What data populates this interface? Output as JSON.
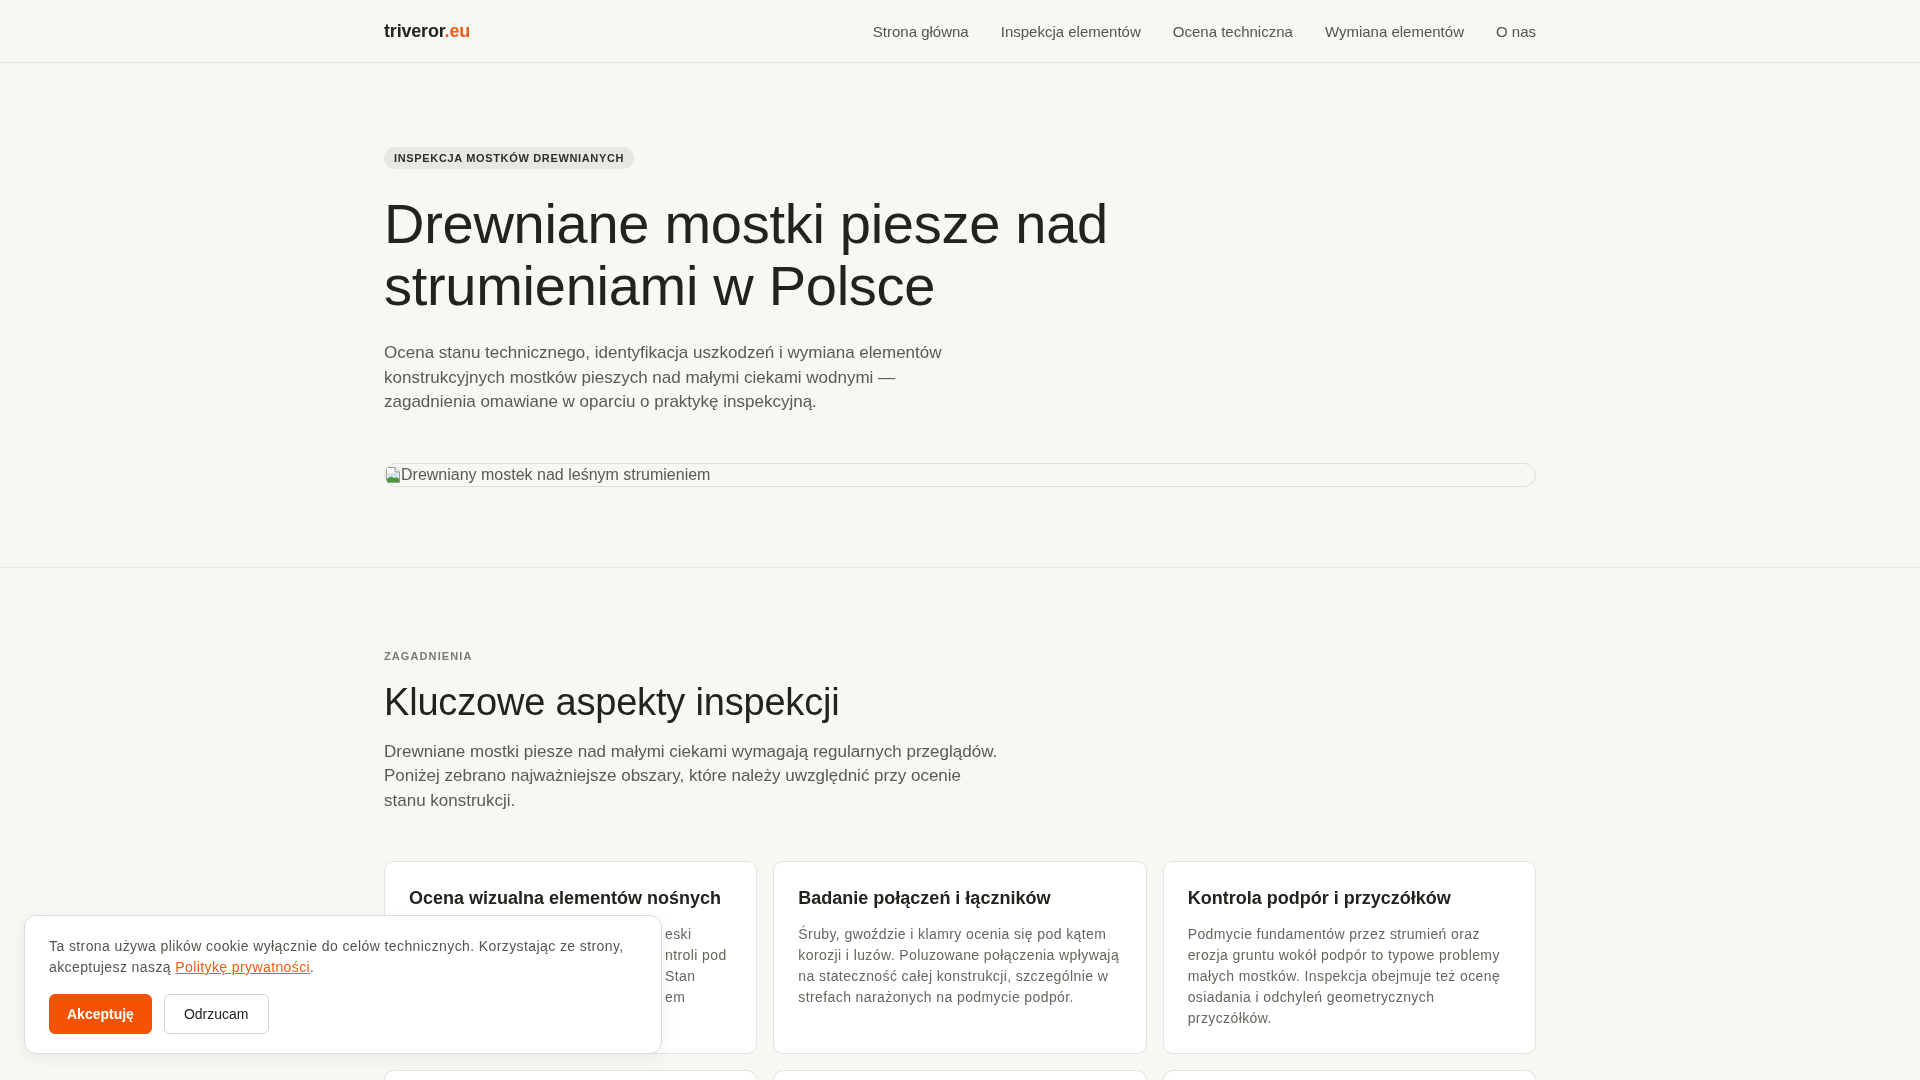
{
  "header": {
    "logo": {
      "name": "triveror",
      "suffix": ".eu"
    },
    "nav": [
      "Strona główna",
      "Inspekcja elementów",
      "Ocena techniczna",
      "Wymiana elementów",
      "O nas"
    ]
  },
  "hero": {
    "badge": "INSPEKCJA MOSTKÓW DREWNIANYCH",
    "title": "Drewniane mostki piesze nad strumieniami w Polsce",
    "intro": "Ocena stanu technicznego, identyfikacja uszkodzeń i wymiana elementów konstrukcyjnych mostków pieszych nad małymi ciekami wodnymi — zagadnienia omawiane w oparciu o praktykę inspekcyjną.",
    "image": {
      "alt_text": "Drewniany mostek nad leśnym strumieniem"
    }
  },
  "topics": {
    "eyebrow": "ZAGADNIENIA",
    "title": "Kluczowe aspekty inspekcji",
    "intro": "Drewniane mostki piesze nad małymi ciekami wymagają regularnych przeglądów. Poniżej zebrano najważniejsze obszary, które należy uwzględnić przy ocenie stanu konstrukcji.",
    "cards": [
      {
        "kind": "covered",
        "title": "Ocena wizualna elementów nośnych",
        "visible_fragments": [
          "eski",
          "ntroli pod",
          "Stan",
          "em"
        ]
      },
      {
        "kind": "full",
        "title": "Badanie połączeń i łączników",
        "body": "Śruby, gwoździe i klamry ocenia się pod kątem korozji i luzów. Poluzowane połączenia wpływają na stateczność całej konstrukcji, szczególnie w strefach narażonych na podmycie podpór."
      },
      {
        "kind": "full",
        "title": "Kontrola podpór i przyczółków",
        "body": "Podmycie fundamentów przez strumień oraz erozja gruntu wokół podpór to typowe problemy małych mostków. Inspekcja obejmuje też ocenę osiadania i odchyleń geometrycznych przyczółków."
      },
      {
        "kind": "cut_off"
      },
      {
        "kind": "cut_off"
      },
      {
        "kind": "cut_off"
      }
    ]
  },
  "cookie_banner": {
    "text": "Ta strona używa plików cookie wyłącznie do celów technicznych. Korzystając ze strony, akceptujesz naszą",
    "link": "Politykę prywatności",
    "text_after_link": ".",
    "buttons": [
      {
        "label": "Akceptuję",
        "kind": "primary"
      },
      {
        "label": "Odrzucam",
        "kind": "secondary"
      }
    ]
  }
}
